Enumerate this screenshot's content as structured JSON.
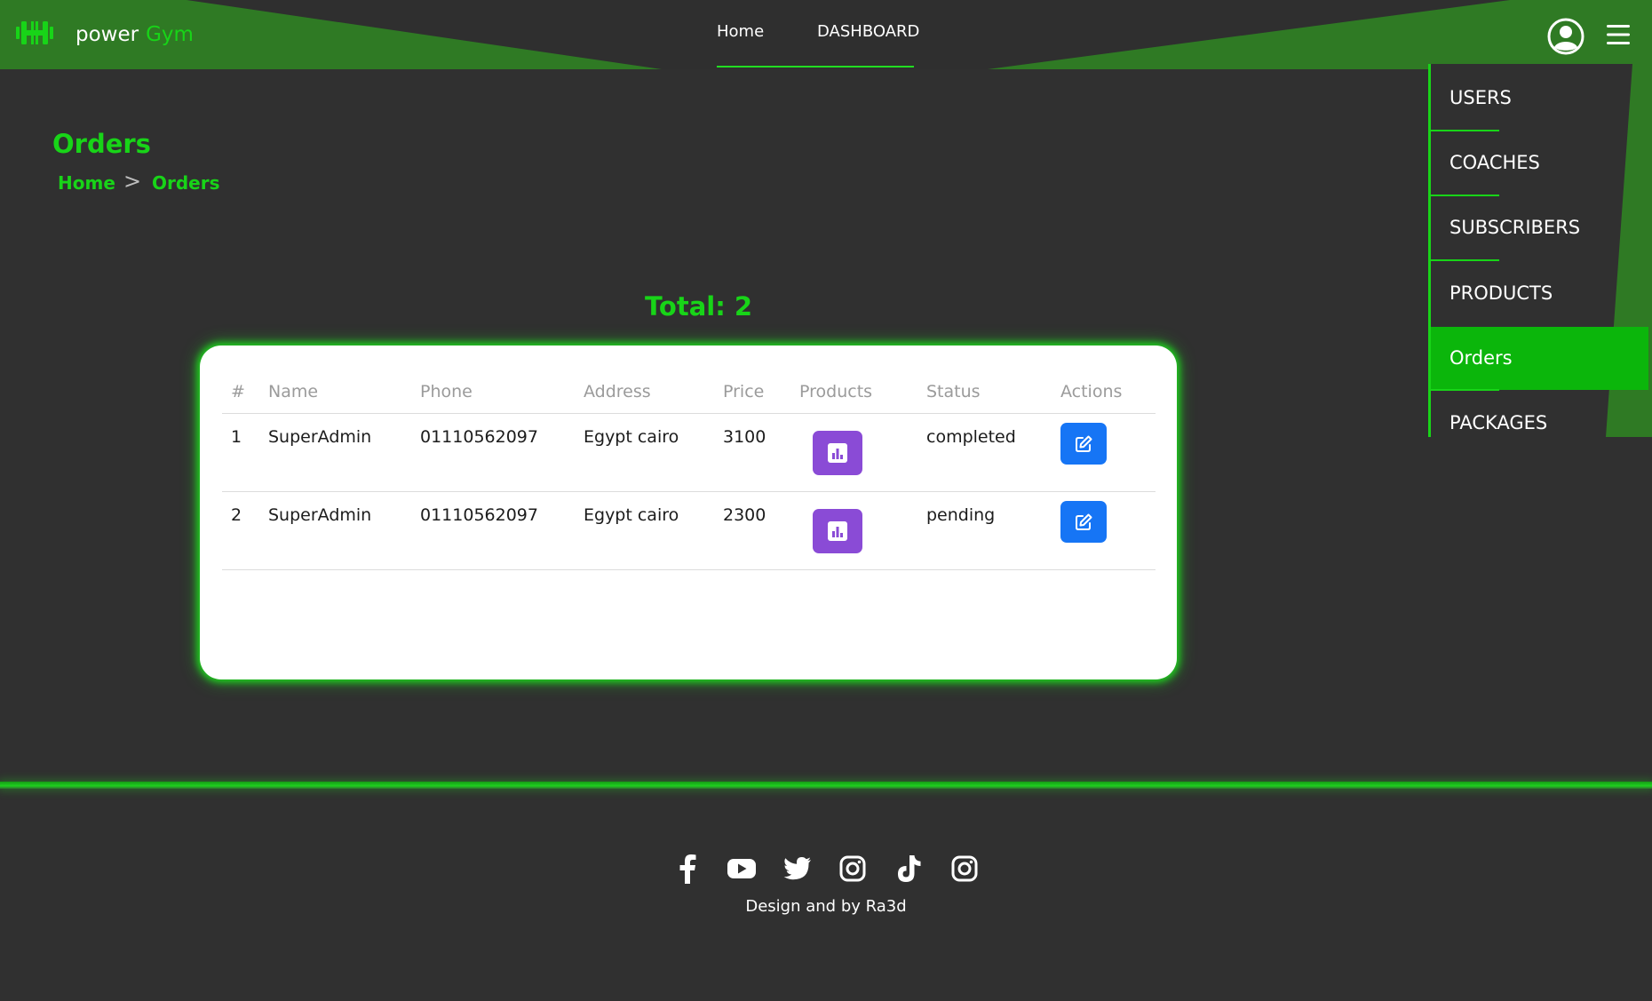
{
  "app": {
    "brand_part1": "power",
    "brand_part2": "Gym"
  },
  "header": {
    "nav": [
      {
        "label": "Home",
        "active": true
      },
      {
        "label": "DASHBOARD",
        "active": true
      }
    ]
  },
  "side_menu": {
    "items": [
      {
        "label": "USERS",
        "active": false
      },
      {
        "label": "COACHES",
        "active": false
      },
      {
        "label": "SUBSCRIBERS",
        "active": false
      },
      {
        "label": "PRODUCTS",
        "active": false
      },
      {
        "label": "Orders",
        "active": true
      },
      {
        "label": "PACKAGES",
        "active": false
      }
    ]
  },
  "page": {
    "title": "Orders",
    "breadcrumb": {
      "home": "Home",
      "separator": ">",
      "current": "Orders"
    },
    "total_label": "Total: 2"
  },
  "table": {
    "columns": [
      "#",
      "Name",
      "Phone",
      "Address",
      "Price",
      "Products",
      "Status",
      "Actions"
    ],
    "rows": [
      {
        "index": "1",
        "name": "SuperAdmin",
        "phone": "01110562097",
        "address": "Egypt cairo",
        "price": "3100",
        "status": "completed"
      },
      {
        "index": "2",
        "name": "SuperAdmin",
        "phone": "01110562097",
        "address": "Egypt cairo",
        "price": "2300",
        "status": "pending"
      }
    ]
  },
  "footer": {
    "social": [
      "facebook-icon",
      "youtube-icon",
      "twitter-icon",
      "instagram-icon",
      "tiktok-icon",
      "instagram-icon"
    ],
    "credit": "Design and by Ra3d"
  },
  "colors": {
    "accent_green": "#18d418",
    "header_green": "#2e7a24",
    "background": "#303030",
    "products_button": "#8a4bd6",
    "edit_button": "#1675f5"
  }
}
